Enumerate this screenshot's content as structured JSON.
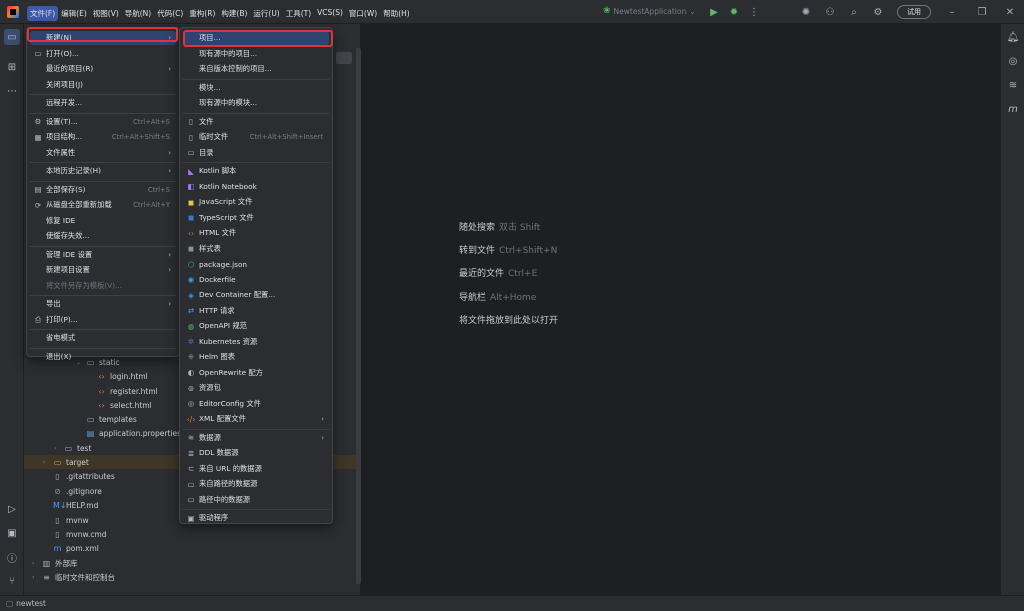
{
  "menubar": [
    {
      "label": "文件(F)",
      "active": true
    },
    {
      "label": "编辑(E)"
    },
    {
      "label": "视图(V)"
    },
    {
      "label": "导航(N)"
    },
    {
      "label": "代码(C)"
    },
    {
      "label": "重构(R)"
    },
    {
      "label": "构建(B)"
    },
    {
      "label": "运行(U)"
    },
    {
      "label": "工具(T)"
    },
    {
      "label": "VCS(S)"
    },
    {
      "label": "窗口(W)"
    },
    {
      "label": "帮助(H)"
    }
  ],
  "toolbar": {
    "run_config": "NewtestApplication",
    "trial_label": "试用"
  },
  "file_menu": {
    "items": [
      {
        "label": "新建(N)",
        "icon": "",
        "shortcut": "",
        "submenu": true,
        "selected": true
      },
      {
        "label": "打开(O)...",
        "icon": "folder-icon",
        "shortcut": ""
      },
      {
        "label": "最近的项目(R)",
        "icon": "",
        "shortcut": "",
        "submenu": true
      },
      {
        "label": "关闭项目(J)",
        "icon": "",
        "shortcut": ""
      },
      {
        "sep": true
      },
      {
        "label": "远程开发...",
        "icon": "",
        "shortcut": ""
      },
      {
        "sep": true
      },
      {
        "label": "设置(T)...",
        "icon": "gear-icon",
        "shortcut": "Ctrl+Alt+S"
      },
      {
        "label": "项目结构...",
        "icon": "structure-icon",
        "shortcut": "Ctrl+Alt+Shift+S"
      },
      {
        "label": "文件属性",
        "icon": "",
        "shortcut": "",
        "submenu": true
      },
      {
        "sep": true
      },
      {
        "label": "本地历史记录(H)",
        "icon": "",
        "shortcut": "",
        "submenu": true
      },
      {
        "sep": true
      },
      {
        "label": "全部保存(S)",
        "icon": "save-icon",
        "shortcut": "Ctrl+S"
      },
      {
        "label": "从磁盘全部重新加载",
        "icon": "reload-icon",
        "shortcut": "Ctrl+Alt+Y"
      },
      {
        "label": "修复 IDE",
        "icon": "",
        "shortcut": ""
      },
      {
        "label": "使缓存失效...",
        "icon": "",
        "shortcut": ""
      },
      {
        "sep": true
      },
      {
        "label": "管理 IDE 设置",
        "icon": "",
        "shortcut": "",
        "submenu": true
      },
      {
        "label": "新建项目设置",
        "icon": "",
        "shortcut": "",
        "submenu": true
      },
      {
        "label": "将文件另存为模板(V)...",
        "icon": "",
        "shortcut": "",
        "disabled": true
      },
      {
        "sep": true
      },
      {
        "label": "导出",
        "icon": "",
        "shortcut": "",
        "submenu": true
      },
      {
        "label": "打印(P)...",
        "icon": "print-icon",
        "shortcut": ""
      },
      {
        "sep": true
      },
      {
        "label": "省电模式",
        "icon": "",
        "shortcut": ""
      },
      {
        "sep": true
      },
      {
        "label": "退出(X)",
        "icon": "",
        "shortcut": ""
      }
    ]
  },
  "new_menu": {
    "items": [
      {
        "label": "项目...",
        "icon": "",
        "selected": true
      },
      {
        "label": "现有源中的项目...",
        "icon": ""
      },
      {
        "label": "来自版本控制的项目...",
        "icon": ""
      },
      {
        "sep": true
      },
      {
        "label": "模块...",
        "icon": ""
      },
      {
        "label": "现有源中的模块...",
        "icon": ""
      },
      {
        "sep": true
      },
      {
        "label": "文件",
        "icon": "file-icon"
      },
      {
        "label": "临时文件",
        "icon": "scratch-file-icon",
        "shortcut": "Ctrl+Alt+Shift+Insert"
      },
      {
        "label": "目录",
        "icon": "folder-icon"
      },
      {
        "sep": true
      },
      {
        "label": "Kotlin 脚本",
        "icon": "kotlin-icon"
      },
      {
        "label": "Kotlin Notebook",
        "icon": "kotlin-notebook-icon"
      },
      {
        "label": "JavaScript 文件",
        "icon": "javascript-icon"
      },
      {
        "label": "TypeScript 文件",
        "icon": "typescript-icon"
      },
      {
        "label": "HTML 文件",
        "icon": "html-icon"
      },
      {
        "label": "样式表",
        "icon": "css-icon"
      },
      {
        "label": "package.json",
        "icon": "nodejs-icon"
      },
      {
        "label": "Dockerfile",
        "icon": "docker-icon"
      },
      {
        "label": "Dev Container 配置...",
        "icon": "devcontainer-icon"
      },
      {
        "label": "HTTP 请求",
        "icon": "http-icon"
      },
      {
        "label": "OpenAPI 规范",
        "icon": "openapi-icon"
      },
      {
        "label": "Kubernetes 资源",
        "icon": "kubernetes-icon"
      },
      {
        "label": "Helm 图表",
        "icon": "helm-icon"
      },
      {
        "label": "OpenRewrite 配方",
        "icon": "openrewrite-icon"
      },
      {
        "label": "资源包",
        "icon": "resource-bundle-icon"
      },
      {
        "label": "EditorConfig 文件",
        "icon": "editorconfig-icon"
      },
      {
        "label": "XML 配置文件",
        "icon": "xml-icon",
        "submenu": true
      },
      {
        "sep": true
      },
      {
        "label": "数据源",
        "icon": "datasource-icon",
        "submenu": true
      },
      {
        "label": "DDL 数据源",
        "icon": "ddl-icon"
      },
      {
        "label": "来自 URL 的数据源",
        "icon": "url-datasource-icon"
      },
      {
        "label": "来自路径的数据源",
        "icon": "path-datasource-icon"
      },
      {
        "label": "路径中的数据源",
        "icon": "path-datasource-icon"
      },
      {
        "sep": true
      },
      {
        "label": "驱动程序",
        "icon": "driver-icon"
      }
    ]
  },
  "project_tree": [
    {
      "label": "static",
      "icon": "folder-icon",
      "indent": 3,
      "arrow": "v"
    },
    {
      "label": "login.html",
      "icon": "html-icon",
      "indent": 4
    },
    {
      "label": "register.html",
      "icon": "html-icon",
      "indent": 4
    },
    {
      "label": "select.html",
      "icon": "html-icon",
      "indent": 4
    },
    {
      "label": "templates",
      "icon": "folder-icon",
      "indent": 3
    },
    {
      "label": "application.properties",
      "icon": "properties-icon",
      "indent": 3
    },
    {
      "label": "test",
      "icon": "folder-icon",
      "indent": 1,
      "arrow": ">"
    },
    {
      "label": "target",
      "icon": "folder-icon",
      "indent": 0,
      "arrow": ">",
      "highlight": true
    },
    {
      "label": ".gitattributes",
      "icon": "file-icon",
      "indent": 0
    },
    {
      "label": ".gitignore",
      "icon": "gitignore-icon",
      "indent": 0
    },
    {
      "label": "HELP.md",
      "icon": "markdown-icon",
      "indent": 0
    },
    {
      "label": "mvnw",
      "icon": "file-icon",
      "indent": 0
    },
    {
      "label": "mvnw.cmd",
      "icon": "file-icon",
      "indent": 0
    },
    {
      "label": "pom.xml",
      "icon": "maven-icon",
      "indent": 0
    },
    {
      "label": "外部库",
      "icon": "library-icon",
      "indent": -1,
      "arrow": ">"
    },
    {
      "label": "临时文件和控制台",
      "icon": "scratches-icon",
      "indent": -1,
      "arrow": ">"
    }
  ],
  "editor_hints": [
    {
      "action": "随处搜索",
      "key": "双击 Shift"
    },
    {
      "action": "转到文件",
      "key": "Ctrl+Shift+N"
    },
    {
      "action": "最近的文件",
      "key": "Ctrl+E"
    },
    {
      "action": "导航栏",
      "key": "Alt+Home"
    },
    {
      "action": "将文件拖放到此处以打开",
      "key": ""
    }
  ],
  "statusbar": {
    "project": "newtest"
  }
}
